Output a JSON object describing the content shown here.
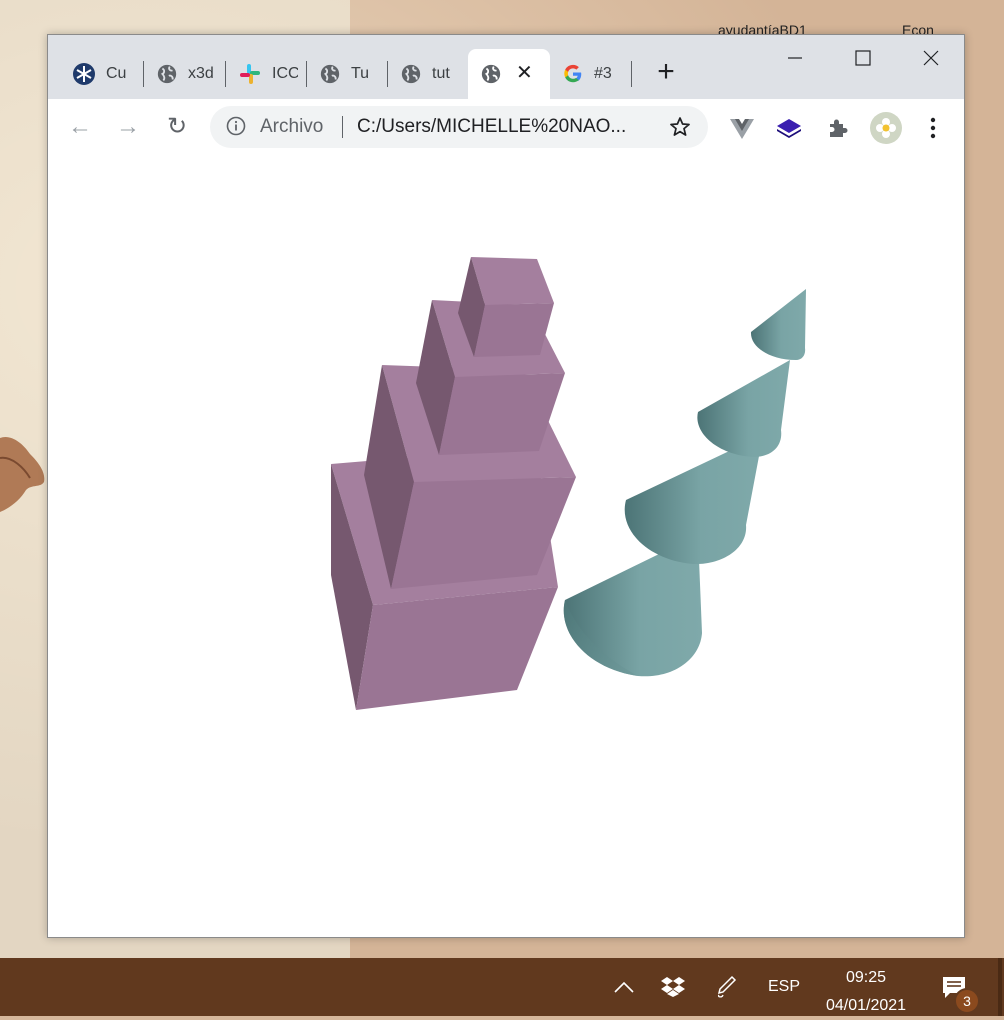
{
  "desktop": {
    "icon_labels": [
      "ayudantíaBD1",
      "Econ"
    ]
  },
  "browser": {
    "tabs": [
      {
        "title": "Cu",
        "icon": "snowflake-icon"
      },
      {
        "title": "x3d",
        "icon": "globe-icon"
      },
      {
        "title": "ICC",
        "icon": "slack-icon"
      },
      {
        "title": "Tu",
        "icon": "globe-icon"
      },
      {
        "title": "tut",
        "icon": "globe-icon"
      },
      {
        "title": "",
        "icon": "globe-icon",
        "active": true,
        "close": "✕"
      },
      {
        "title": "#3",
        "icon": "google-icon"
      }
    ],
    "new_tab": "+",
    "window_controls": [
      "minimize",
      "maximize",
      "close"
    ],
    "toolbar": {
      "back": "←",
      "forward": "→",
      "reload": "↻",
      "omnibox_chip": "Archivo",
      "url": "C:/Users/MICHELLE%20NAO...",
      "bookmark_icon": "star-icon",
      "extensions": [
        "vue-devtools-icon",
        "layers-extension-icon",
        "puzzle-extensions-icon",
        "profile-avatar-icon",
        "kebab-menu-icon"
      ]
    }
  },
  "scene": {
    "objects": [
      "stacked-cubes",
      "stacked-cones"
    ],
    "colors": {
      "cube": "#9c7596",
      "cone": "#75a2a4"
    }
  },
  "taskbar": {
    "language": "ESP",
    "time": "09:25",
    "date": "04/01/2021",
    "notifications_count": "3",
    "tray_icons": [
      "chevron-up-icon",
      "dropbox-icon",
      "pen-icon"
    ]
  }
}
